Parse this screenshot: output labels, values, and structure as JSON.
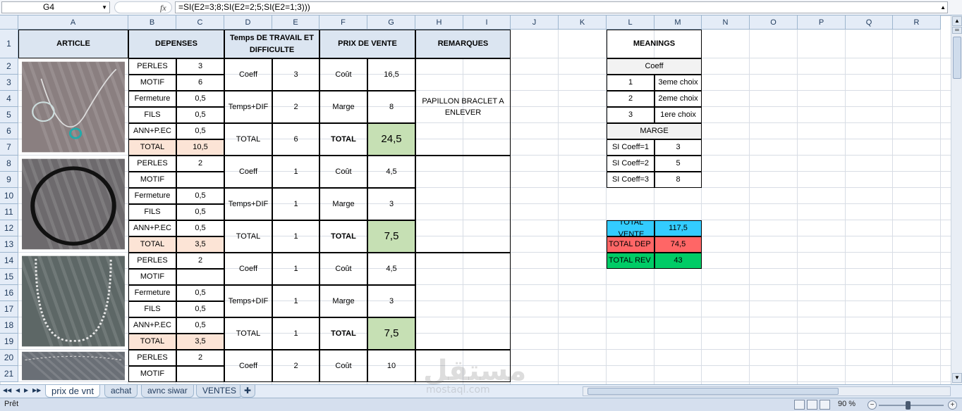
{
  "formula_bar": {
    "name_box": "G4",
    "fx_label": "fx",
    "formula": "=SI(E2=3;8;SI(E2=2;5;SI(E2=1;3)))"
  },
  "columns": [
    "A",
    "B",
    "C",
    "D",
    "E",
    "F",
    "G",
    "H",
    "I",
    "J",
    "K",
    "L",
    "M",
    "N",
    "O",
    "P",
    "Q",
    "R"
  ],
  "rows": [
    "1",
    "2",
    "3",
    "4",
    "5",
    "6",
    "7",
    "8",
    "9",
    "10",
    "11",
    "12",
    "13",
    "14",
    "15",
    "16",
    "17",
    "18",
    "19",
    "20",
    "21"
  ],
  "headers": {
    "article": "ARTICLE",
    "depenses": "DEPENSES",
    "temps": "Temps DE TRAVAIL ET DIFFICULTE",
    "prix": "PRIX DE VENTE",
    "remarques": "REMARQUES"
  },
  "products": [
    {
      "depenses": [
        [
          "PERLES",
          "3"
        ],
        [
          "MOTIF",
          "6"
        ],
        [
          "Fermeture",
          "0,5"
        ],
        [
          "FILS",
          "0,5"
        ],
        [
          "ANN+P.EC",
          "0,5"
        ],
        [
          "TOTAL",
          "10,5"
        ]
      ],
      "temps": [
        [
          "Coeff",
          "3"
        ],
        [
          "Temps+DIF",
          "2"
        ],
        [
          "TOTAL",
          "6"
        ]
      ],
      "prix": [
        [
          "Coût",
          "16,5"
        ],
        [
          "Marge",
          "8"
        ],
        [
          "TOTAL",
          "24,5"
        ]
      ],
      "remarque": "PAPILLON BRACLET A ENLEVER"
    },
    {
      "depenses": [
        [
          "PERLES",
          "2"
        ],
        [
          "MOTIF",
          ""
        ],
        [
          "Fermeture",
          "0,5"
        ],
        [
          "FILS",
          "0,5"
        ],
        [
          "ANN+P.EC",
          "0,5"
        ],
        [
          "TOTAL",
          "3,5"
        ]
      ],
      "temps": [
        [
          "Coeff",
          "1"
        ],
        [
          "Temps+DIF",
          "1"
        ],
        [
          "TOTAL",
          "1"
        ]
      ],
      "prix": [
        [
          "Coût",
          "4,5"
        ],
        [
          "Marge",
          "3"
        ],
        [
          "TOTAL",
          "7,5"
        ]
      ],
      "remarque": ""
    },
    {
      "depenses": [
        [
          "PERLES",
          "2"
        ],
        [
          "MOTIF",
          ""
        ],
        [
          "Fermeture",
          "0,5"
        ],
        [
          "FILS",
          "0,5"
        ],
        [
          "ANN+P.EC",
          "0,5"
        ],
        [
          "TOTAL",
          "3,5"
        ]
      ],
      "temps": [
        [
          "Coeff",
          "1"
        ],
        [
          "Temps+DIF",
          "1"
        ],
        [
          "TOTAL",
          "1"
        ]
      ],
      "prix": [
        [
          "Coût",
          "4,5"
        ],
        [
          "Marge",
          "3"
        ],
        [
          "TOTAL",
          "7,5"
        ]
      ],
      "remarque": ""
    },
    {
      "depenses": [
        [
          "PERLES",
          "2"
        ],
        [
          "MOTIF",
          ""
        ]
      ],
      "temps": [
        [
          "Coeff",
          "2"
        ]
      ],
      "prix": [
        [
          "Coût",
          "10"
        ]
      ],
      "remarque": ""
    }
  ],
  "meanings": {
    "title": "MEANINGS",
    "coeff_header": "Coeff",
    "coeff_rows": [
      [
        "1",
        "3eme choix"
      ],
      [
        "2",
        "2eme choix"
      ],
      [
        "3",
        "1ere choix"
      ]
    ],
    "marge_header": "MARGE",
    "marge_rows": [
      [
        "SI Coeff=1",
        "3"
      ],
      [
        "SI Coeff=2",
        "5"
      ],
      [
        "SI Coeff=3",
        "8"
      ]
    ]
  },
  "totals": [
    {
      "label": "TOTAL VENTE",
      "value": "117,5",
      "color": "#33ccff"
    },
    {
      "label": "TOTAL DEP",
      "value": "74,5",
      "color": "#ff6666"
    },
    {
      "label": "TOTAL REV",
      "value": "43",
      "color": "#00cc66"
    }
  ],
  "sheet_tabs": [
    "prix de vnt",
    "achat",
    "avnc siwar",
    "VENTES"
  ],
  "active_tab": "prix de vnt",
  "status": {
    "ready": "Prêt",
    "zoom": "90 %"
  },
  "watermark": {
    "main": "مستقل",
    "sub": "mostaql.com"
  }
}
